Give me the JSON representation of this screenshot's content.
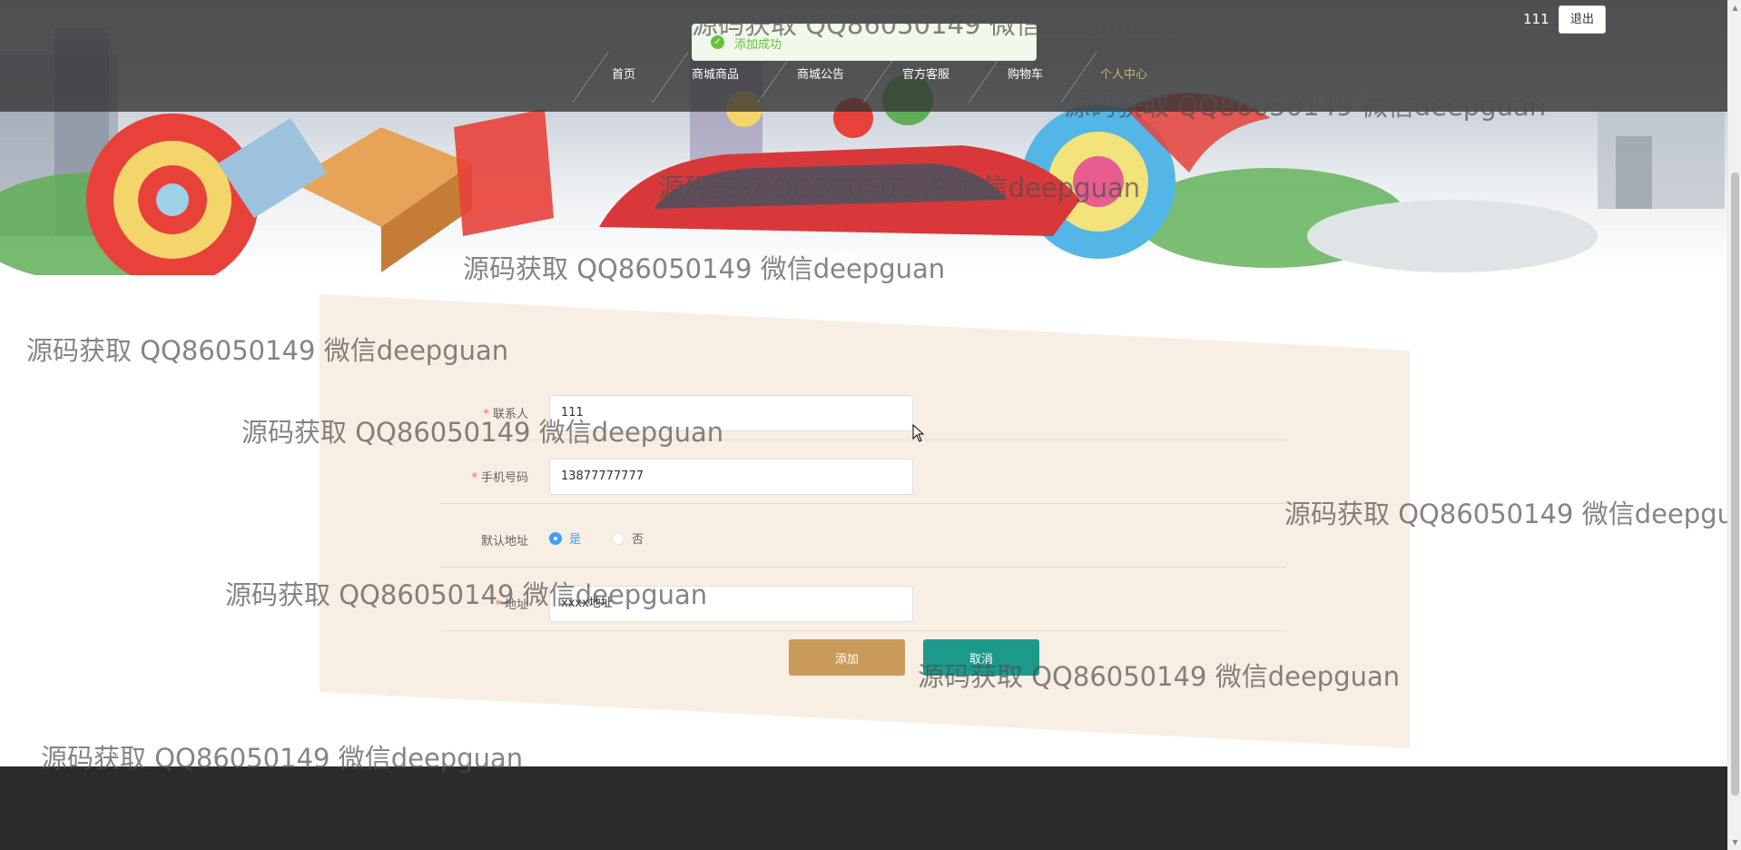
{
  "topbar": {
    "username": "111",
    "logout_label": "退出"
  },
  "nav": {
    "items": [
      {
        "label": "首页",
        "active": false
      },
      {
        "label": "商城商品",
        "active": false
      },
      {
        "label": "商城公告",
        "active": false
      },
      {
        "label": "官方客服",
        "active": false
      },
      {
        "label": "购物车",
        "active": false
      },
      {
        "label": "个人中心",
        "active": true
      }
    ]
  },
  "toast": {
    "message": "添加成功"
  },
  "form": {
    "contact": {
      "label": "联系人",
      "value": "111"
    },
    "phone": {
      "label": "手机号码",
      "value": "13877777777"
    },
    "default_address": {
      "label": "默认地址",
      "options": [
        "是",
        "否"
      ],
      "selected": "是"
    },
    "address": {
      "label": "地址",
      "value": "xxxx地址"
    },
    "required_mark": "*",
    "add_label": "添加",
    "cancel_label": "取消"
  },
  "watermark": {
    "text": "源码获取 QQ86050149 微信deepguan"
  },
  "colors": {
    "accent": "#c99a5a",
    "cancel": "#1b9a8c",
    "nav_active": "#d4b06a",
    "form_bg": "#f9eee3",
    "footer": "#2b2b2b"
  }
}
